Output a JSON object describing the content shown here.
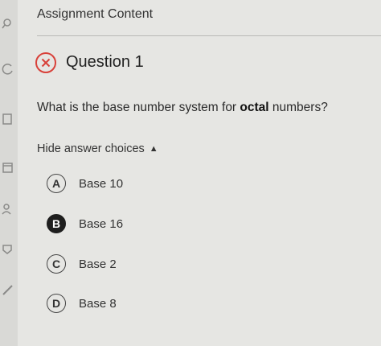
{
  "header": {
    "title": "Assignment Content"
  },
  "question": {
    "status_icon": "x-circle-icon",
    "status_color": "#d8413a",
    "title": "Question 1",
    "text_before": "What is the base number system for ",
    "text_bold": "octal",
    "text_after": " numbers?",
    "toggle_label": "Hide answer choices",
    "choices": [
      {
        "letter": "A",
        "label": "Base 10",
        "selected": false
      },
      {
        "letter": "B",
        "label": "Base 16",
        "selected": true
      },
      {
        "letter": "C",
        "label": "Base 2",
        "selected": false
      },
      {
        "letter": "D",
        "label": "Base 8",
        "selected": false
      }
    ]
  },
  "colors": {
    "background": "#e6e6e3",
    "selected_choice": "#1e1e1e"
  }
}
